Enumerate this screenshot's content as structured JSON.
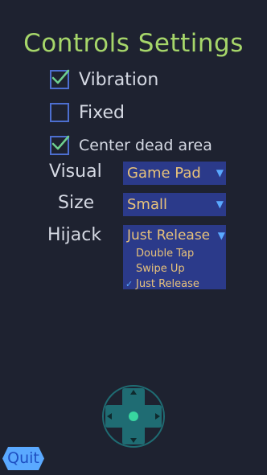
{
  "title": "Controls Settings",
  "options": {
    "vibration": {
      "label": "Vibration",
      "checked": true
    },
    "fixed": {
      "label": "Fixed",
      "checked": false
    },
    "center_dead_area": {
      "label": "Center dead area",
      "checked": true
    }
  },
  "visual": {
    "label": "Visual",
    "value": "Game Pad"
  },
  "size": {
    "label": "Size",
    "value": "Small"
  },
  "hijack": {
    "label": "Hijack",
    "value": "Just Release",
    "options": [
      "Double Tap",
      "Swipe Up",
      "Just Release"
    ],
    "selected": "Just Release"
  },
  "quit_label": "Quit",
  "colors": {
    "background": "#1e2230",
    "title": "#a6d66a",
    "checkbox_border": "#4d6fd0",
    "checkmark": "#6ecf8e",
    "select_bg": "#2b3a8a",
    "select_text": "#e8c27a",
    "dropdown_arrow": "#5aa9ff",
    "dpad": "#1f6c73",
    "dpad_center": "#38d6a0",
    "quit_bg": "#5aa9ff",
    "quit_text": "#1e4fc2"
  },
  "icons": {
    "checkmark": "checkmark-icon",
    "dropdown": "chevron-down-icon",
    "dpad": "dpad-icon"
  }
}
